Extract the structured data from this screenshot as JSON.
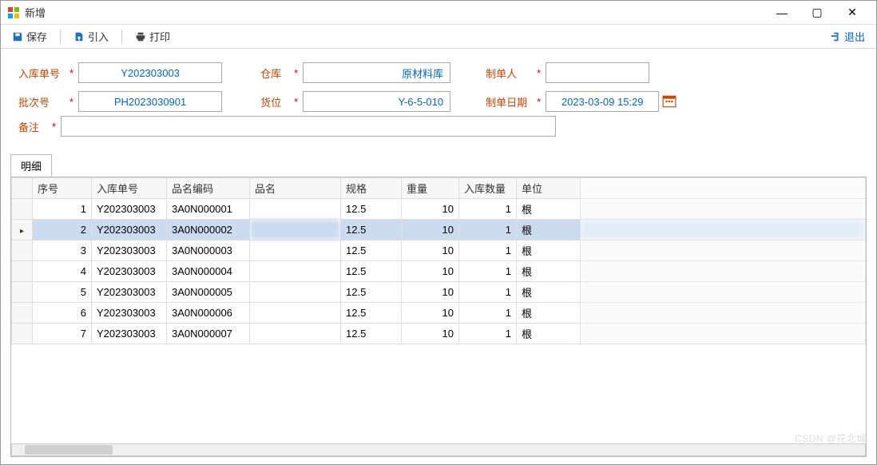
{
  "window": {
    "title": "新增"
  },
  "toolbar": {
    "save": "保存",
    "import": "引入",
    "print": "打印",
    "exit": "退出"
  },
  "form": {
    "labels": {
      "rkdh": "入库单号",
      "pch": "批次号",
      "ck": "仓库",
      "hw": "货位",
      "zdr": "制单人",
      "zdrq": "制单日期",
      "bz": "备注"
    },
    "values": {
      "rkdh": "Y202303003",
      "pch": "PH2023030901",
      "ck": "原材料库",
      "hw": "Y-6-5-010",
      "zdr": "",
      "zdrq": "2023-03-09 15:29",
      "bz": ""
    }
  },
  "tabs": {
    "detail": "明细"
  },
  "grid": {
    "headers": {
      "seq": "序号",
      "rkdh": "入库单号",
      "pmbm": "品名编码",
      "pm": "品名",
      "gg": "规格",
      "zl": "重量",
      "rksl": "入库数量",
      "dw": "单位"
    },
    "rows": [
      {
        "seq": "1",
        "rkdh": "Y202303003",
        "pmbm": "3A0N000001",
        "pm": "",
        "gg": "12.5",
        "zl": "10",
        "rksl": "1",
        "dw": "根"
      },
      {
        "seq": "2",
        "rkdh": "Y202303003",
        "pmbm": "3A0N000002",
        "pm": "",
        "gg": "12.5",
        "zl": "10",
        "rksl": "1",
        "dw": "根"
      },
      {
        "seq": "3",
        "rkdh": "Y202303003",
        "pmbm": "3A0N000003",
        "pm": "",
        "gg": "12.5",
        "zl": "10",
        "rksl": "1",
        "dw": "根"
      },
      {
        "seq": "4",
        "rkdh": "Y202303003",
        "pmbm": "3A0N000004",
        "pm": "",
        "gg": "12.5",
        "zl": "10",
        "rksl": "1",
        "dw": "根"
      },
      {
        "seq": "5",
        "rkdh": "Y202303003",
        "pmbm": "3A0N000005",
        "pm": "",
        "gg": "12.5",
        "zl": "10",
        "rksl": "1",
        "dw": "根"
      },
      {
        "seq": "6",
        "rkdh": "Y202303003",
        "pmbm": "3A0N000006",
        "pm": "",
        "gg": "12.5",
        "zl": "10",
        "rksl": "1",
        "dw": "根"
      },
      {
        "seq": "7",
        "rkdh": "Y202303003",
        "pmbm": "3A0N000007",
        "pm": "",
        "gg": "12.5",
        "zl": "10",
        "rksl": "1",
        "dw": "根"
      }
    ],
    "selected_index": 1
  },
  "watermark": "CSDN @花北城"
}
